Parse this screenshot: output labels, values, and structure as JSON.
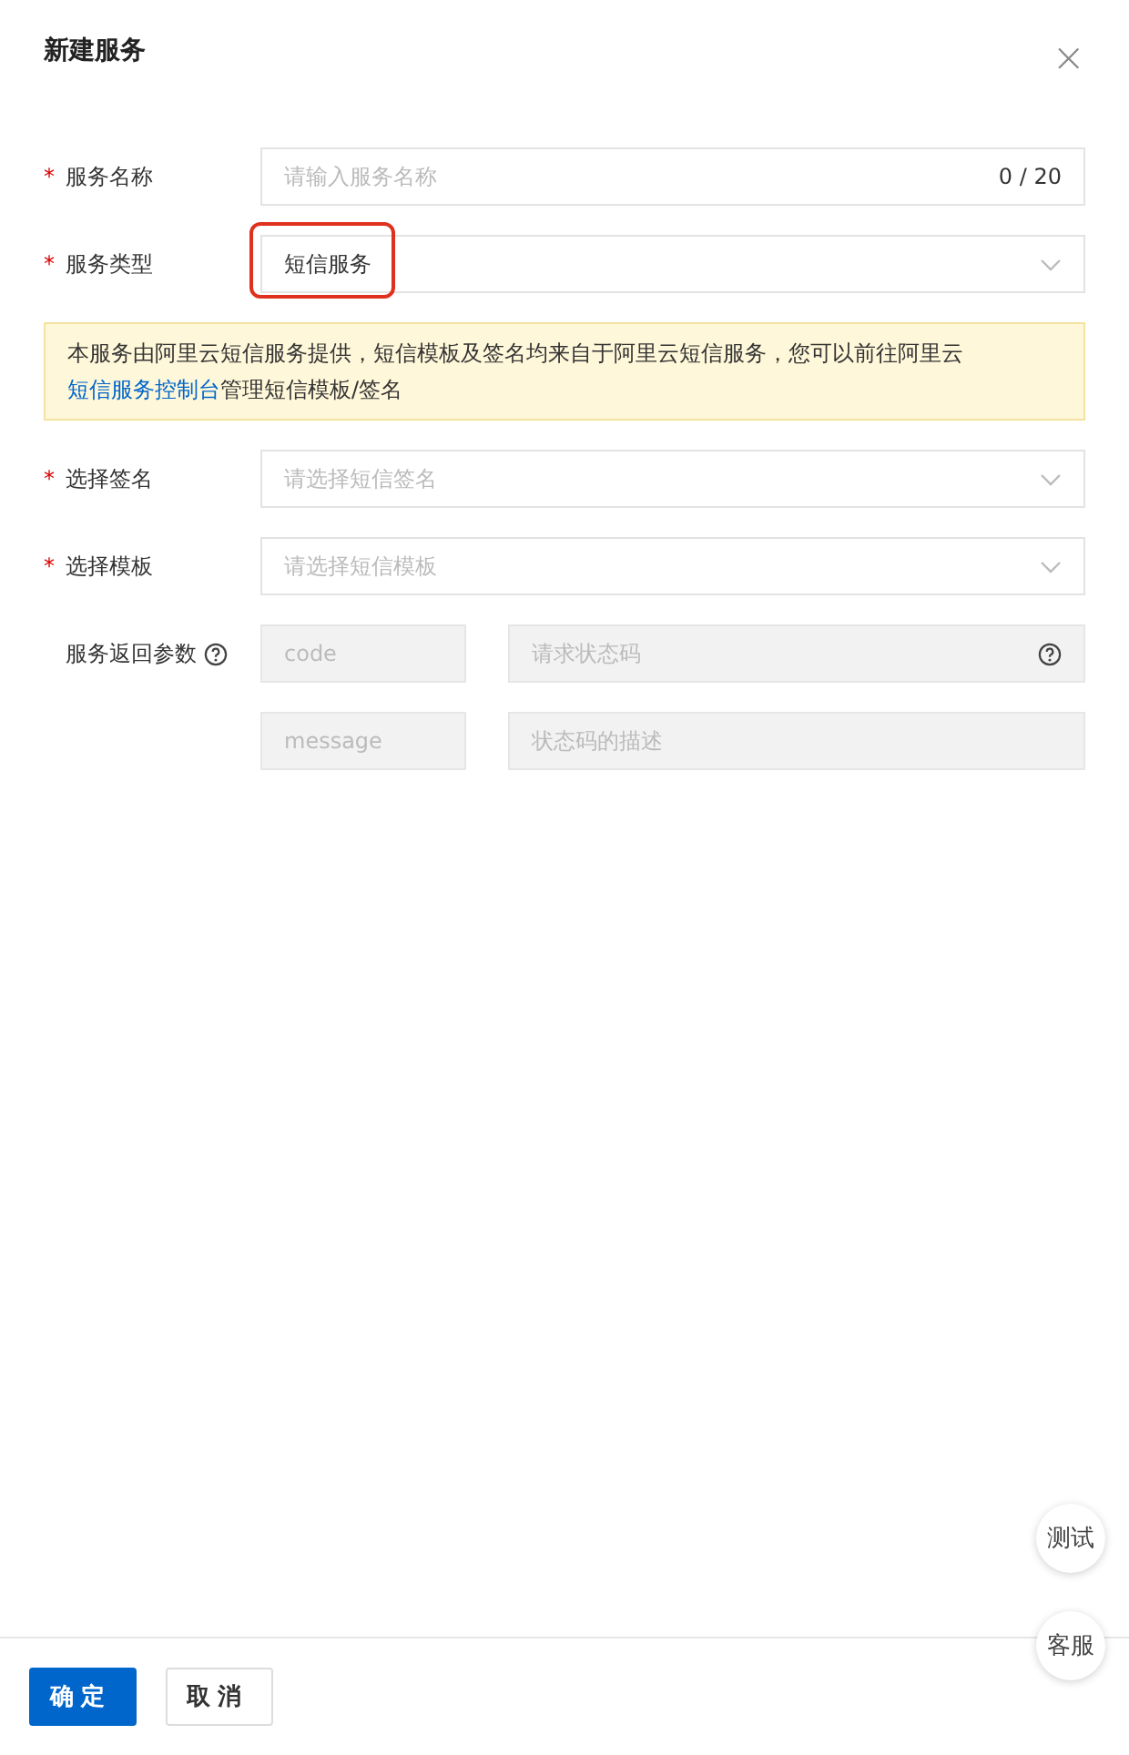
{
  "dialog": {
    "title": "新建服务",
    "close": "×"
  },
  "fields": [
    {
      "kind": "input",
      "label": "服务名称",
      "required": true,
      "placeholder": "请输入服务名称",
      "counter": "0 / 20"
    },
    {
      "kind": "select",
      "label": "服务类型",
      "required": true,
      "value": "短信服务",
      "highlighted": true
    },
    {
      "kind": "notice",
      "text": "本服务由阿里云短信服务提供，短信模板及签名均来自于阿里云短信服务，您可以前往阿里云",
      "link": "短信服务控制台",
      "text_after": "管理短信模板/签名"
    },
    {
      "kind": "select",
      "label": "选择签名",
      "required": true,
      "placeholder": "请选择短信签名",
      "highlighted": false
    },
    {
      "kind": "select",
      "label": "选择模板",
      "required": true,
      "placeholder": "请选择短信模板",
      "highlighted": false
    },
    {
      "kind": "params",
      "label": "服务返回参数",
      "required": false,
      "rows": [
        {
          "key": "code",
          "description": "请求状态码",
          "help": true
        },
        {
          "key": "message",
          "description": "状态码的描述",
          "help": false
        }
      ]
    }
  ],
  "required_mark": "*",
  "floating_buttons": [
    "测试",
    "客服"
  ],
  "footer": {
    "buttons": [
      {
        "label": "确定",
        "primary": true
      },
      {
        "label": "取消",
        "primary": false
      }
    ]
  }
}
